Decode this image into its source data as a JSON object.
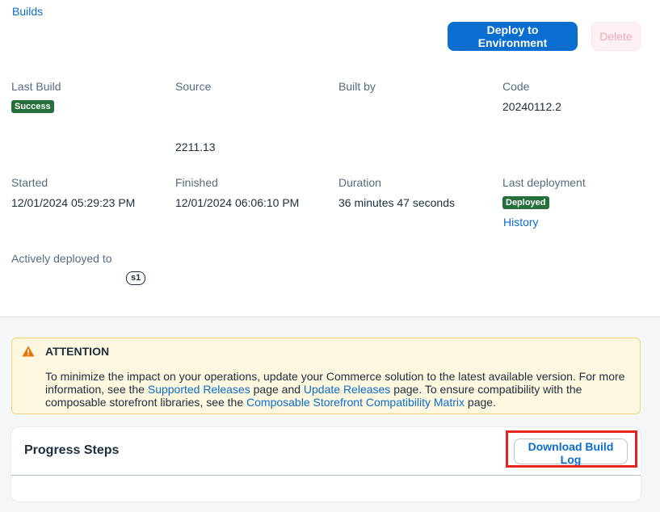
{
  "breadcrumb": {
    "builds": "Builds"
  },
  "actions": {
    "deploy_label": "Deploy to Environment",
    "delete_label": "Delete"
  },
  "details": {
    "last_build": {
      "label": "Last Build",
      "status": "Success"
    },
    "source": {
      "label": "Source",
      "value": "2211.13"
    },
    "built_by": {
      "label": "Built by",
      "value": ""
    },
    "code": {
      "label": "Code",
      "value": "20240112.2"
    },
    "started": {
      "label": "Started",
      "value": "12/01/2024 05:29:23 PM"
    },
    "finished": {
      "label": "Finished",
      "value": "12/01/2024 06:06:10 PM"
    },
    "duration": {
      "label": "Duration",
      "value": "36 minutes 47 seconds"
    },
    "last_deployment": {
      "label": "Last deployment",
      "status": "Deployed",
      "history_link": "History"
    },
    "actively_deployed": {
      "label": "Actively deployed to",
      "env": "s1"
    }
  },
  "attention": {
    "icon": "warning-icon",
    "title": "ATTENTION",
    "text_1": "To minimize the impact on your operations, update your Commerce solution to the latest available version. For more information, see the ",
    "link_1": "Supported Releases",
    "text_2": " page and ",
    "link_2": "Update Releases",
    "text_3": " page. To ensure compatibility with the composable storefront libraries, see the ",
    "link_3": "Composable Storefront Compatibility Matrix",
    "text_4": " page."
  },
  "progress": {
    "title": "Progress Steps",
    "download_label": "Download Build Log"
  },
  "colors": {
    "accent": "#0a6ed1",
    "success": "#256f3a",
    "warning_bg": "#fef7e0",
    "highlight": "#e8231f"
  }
}
